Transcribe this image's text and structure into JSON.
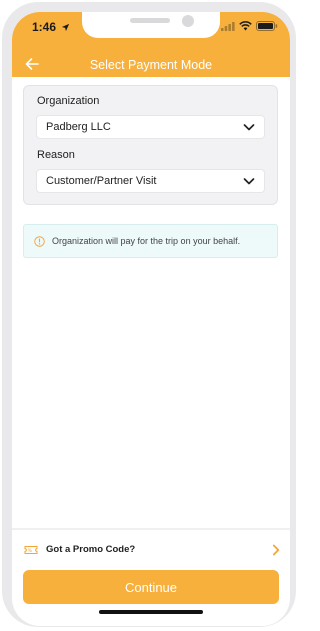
{
  "status_bar": {
    "time": "1:46"
  },
  "header": {
    "title": "Select Payment Mode"
  },
  "form": {
    "organization": {
      "label": "Organization",
      "selected": "Padberg LLC"
    },
    "reason": {
      "label": "Reason",
      "selected": "Customer/Partner Visit"
    }
  },
  "info": {
    "message": "Organization will pay for the trip on your behalf."
  },
  "promo": {
    "label": "Got a Promo Code?"
  },
  "actions": {
    "continue_label": "Continue"
  },
  "icons": {
    "back": "arrow-left-icon",
    "dropdown": "chevron-down-icon",
    "info": "info-circle-icon",
    "promo": "promo-ticket-icon",
    "promo_chevron": "chevron-right-icon",
    "location": "location-arrow-icon",
    "signal": "signal-icon",
    "wifi": "wifi-icon",
    "battery": "battery-icon"
  },
  "colors": {
    "accent": "#f7b03c",
    "info_bg": "#eefafa",
    "card_bg": "#f2f2f4"
  }
}
